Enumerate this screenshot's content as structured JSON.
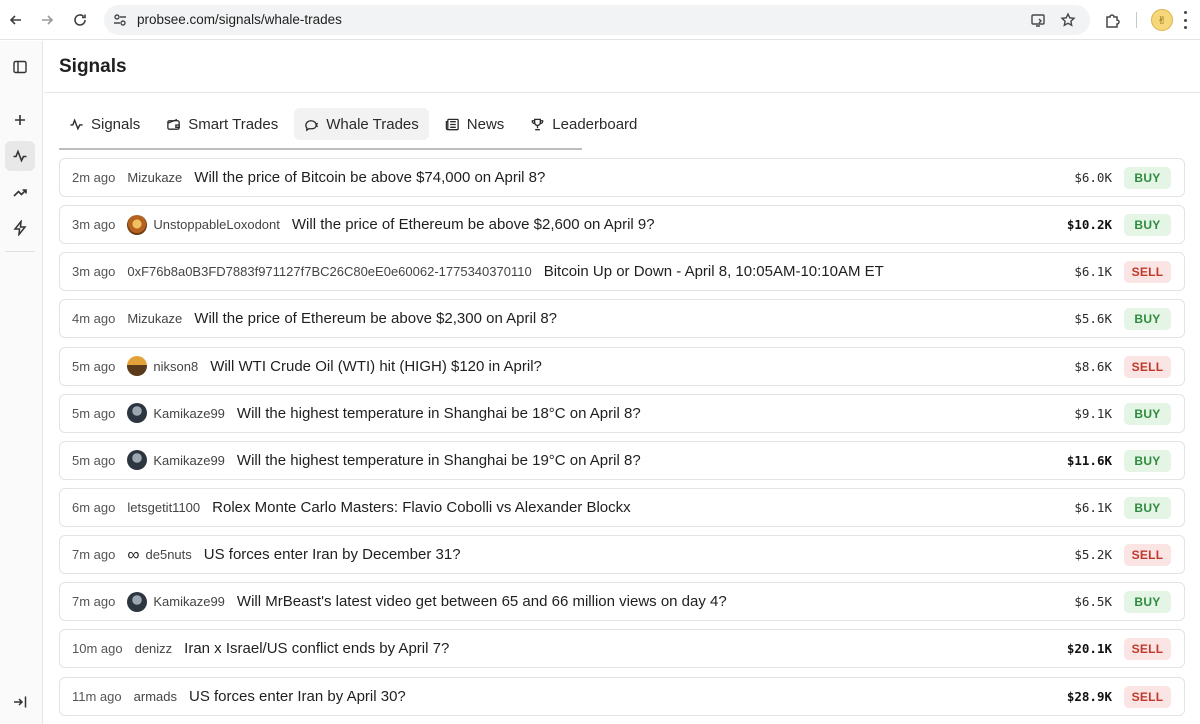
{
  "browser": {
    "url": "probsee.com/signals/whale-trades"
  },
  "page": {
    "title": "Signals"
  },
  "tabs": [
    {
      "label": "Signals",
      "icon": "activity-icon"
    },
    {
      "label": "Smart Trades",
      "icon": "wallet-icon"
    },
    {
      "label": "Whale Trades",
      "icon": "whale-icon",
      "active": true
    },
    {
      "label": "News",
      "icon": "newspaper-icon"
    },
    {
      "label": "Leaderboard",
      "icon": "trophy-icon"
    }
  ],
  "colors": {
    "buy_bg": "#e4f5e6",
    "buy_text": "#2e8b3e",
    "sell_bg": "#fbe4e4",
    "sell_text": "#c0392b"
  },
  "trades": [
    {
      "time": "2m ago",
      "user": "Mizukaze",
      "avatar": "none",
      "question": "Will the price of Bitcoin be above $74,000 on April 8?",
      "amount": "$6.0K",
      "amount_bold": false,
      "side": "BUY"
    },
    {
      "time": "3m ago",
      "user": "UnstoppableLoxodont",
      "avatar": "unstop",
      "question": "Will the price of Ethereum be above $2,600 on April 9?",
      "amount": "$10.2K",
      "amount_bold": true,
      "side": "BUY"
    },
    {
      "time": "3m ago",
      "user": "0xF76b8a0B3FD7883f971127f7BC26C80eE0e60062-1775340370110",
      "avatar": "none",
      "question": "Bitcoin Up or Down - April 8, 10:05AM-10:10AM ET",
      "amount": "$6.1K",
      "amount_bold": false,
      "side": "SELL"
    },
    {
      "time": "4m ago",
      "user": "Mizukaze",
      "avatar": "none",
      "question": "Will the price of Ethereum be above $2,300 on April 8?",
      "amount": "$5.6K",
      "amount_bold": false,
      "side": "BUY"
    },
    {
      "time": "5m ago",
      "user": "nikson8",
      "avatar": "nikson",
      "question": "Will WTI Crude Oil (WTI) hit (HIGH) $120 in April?",
      "amount": "$8.6K",
      "amount_bold": false,
      "side": "SELL"
    },
    {
      "time": "5m ago",
      "user": "Kamikaze99",
      "avatar": "kami",
      "question": "Will the highest temperature in Shanghai be 18°C on April 8?",
      "amount": "$9.1K",
      "amount_bold": false,
      "side": "BUY"
    },
    {
      "time": "5m ago",
      "user": "Kamikaze99",
      "avatar": "kami",
      "question": "Will the highest temperature in Shanghai be 19°C on April 8?",
      "amount": "$11.6K",
      "amount_bold": true,
      "side": "BUY"
    },
    {
      "time": "6m ago",
      "user": "letsgetit1100",
      "avatar": "none",
      "question": "Rolex Monte Carlo Masters: Flavio Cobolli vs Alexander Blockx",
      "amount": "$6.1K",
      "amount_bold": false,
      "side": "BUY"
    },
    {
      "time": "7m ago",
      "user": "de5nuts",
      "avatar": "infinity",
      "question": "US forces enter Iran by December 31?",
      "amount": "$5.2K",
      "amount_bold": false,
      "side": "SELL"
    },
    {
      "time": "7m ago",
      "user": "Kamikaze99",
      "avatar": "kami",
      "question": "Will MrBeast's latest video get between 65 and 66 million views on day 4?",
      "amount": "$6.5K",
      "amount_bold": false,
      "side": "BUY"
    },
    {
      "time": "10m ago",
      "user": "denizz",
      "avatar": "none",
      "question": "Iran x Israel/US conflict ends by April 7?",
      "amount": "$20.1K",
      "amount_bold": true,
      "side": "SELL"
    },
    {
      "time": "11m ago",
      "user": "armads",
      "avatar": "none",
      "question": "US forces enter Iran by April 30?",
      "amount": "$28.9K",
      "amount_bold": true,
      "side": "SELL"
    }
  ]
}
